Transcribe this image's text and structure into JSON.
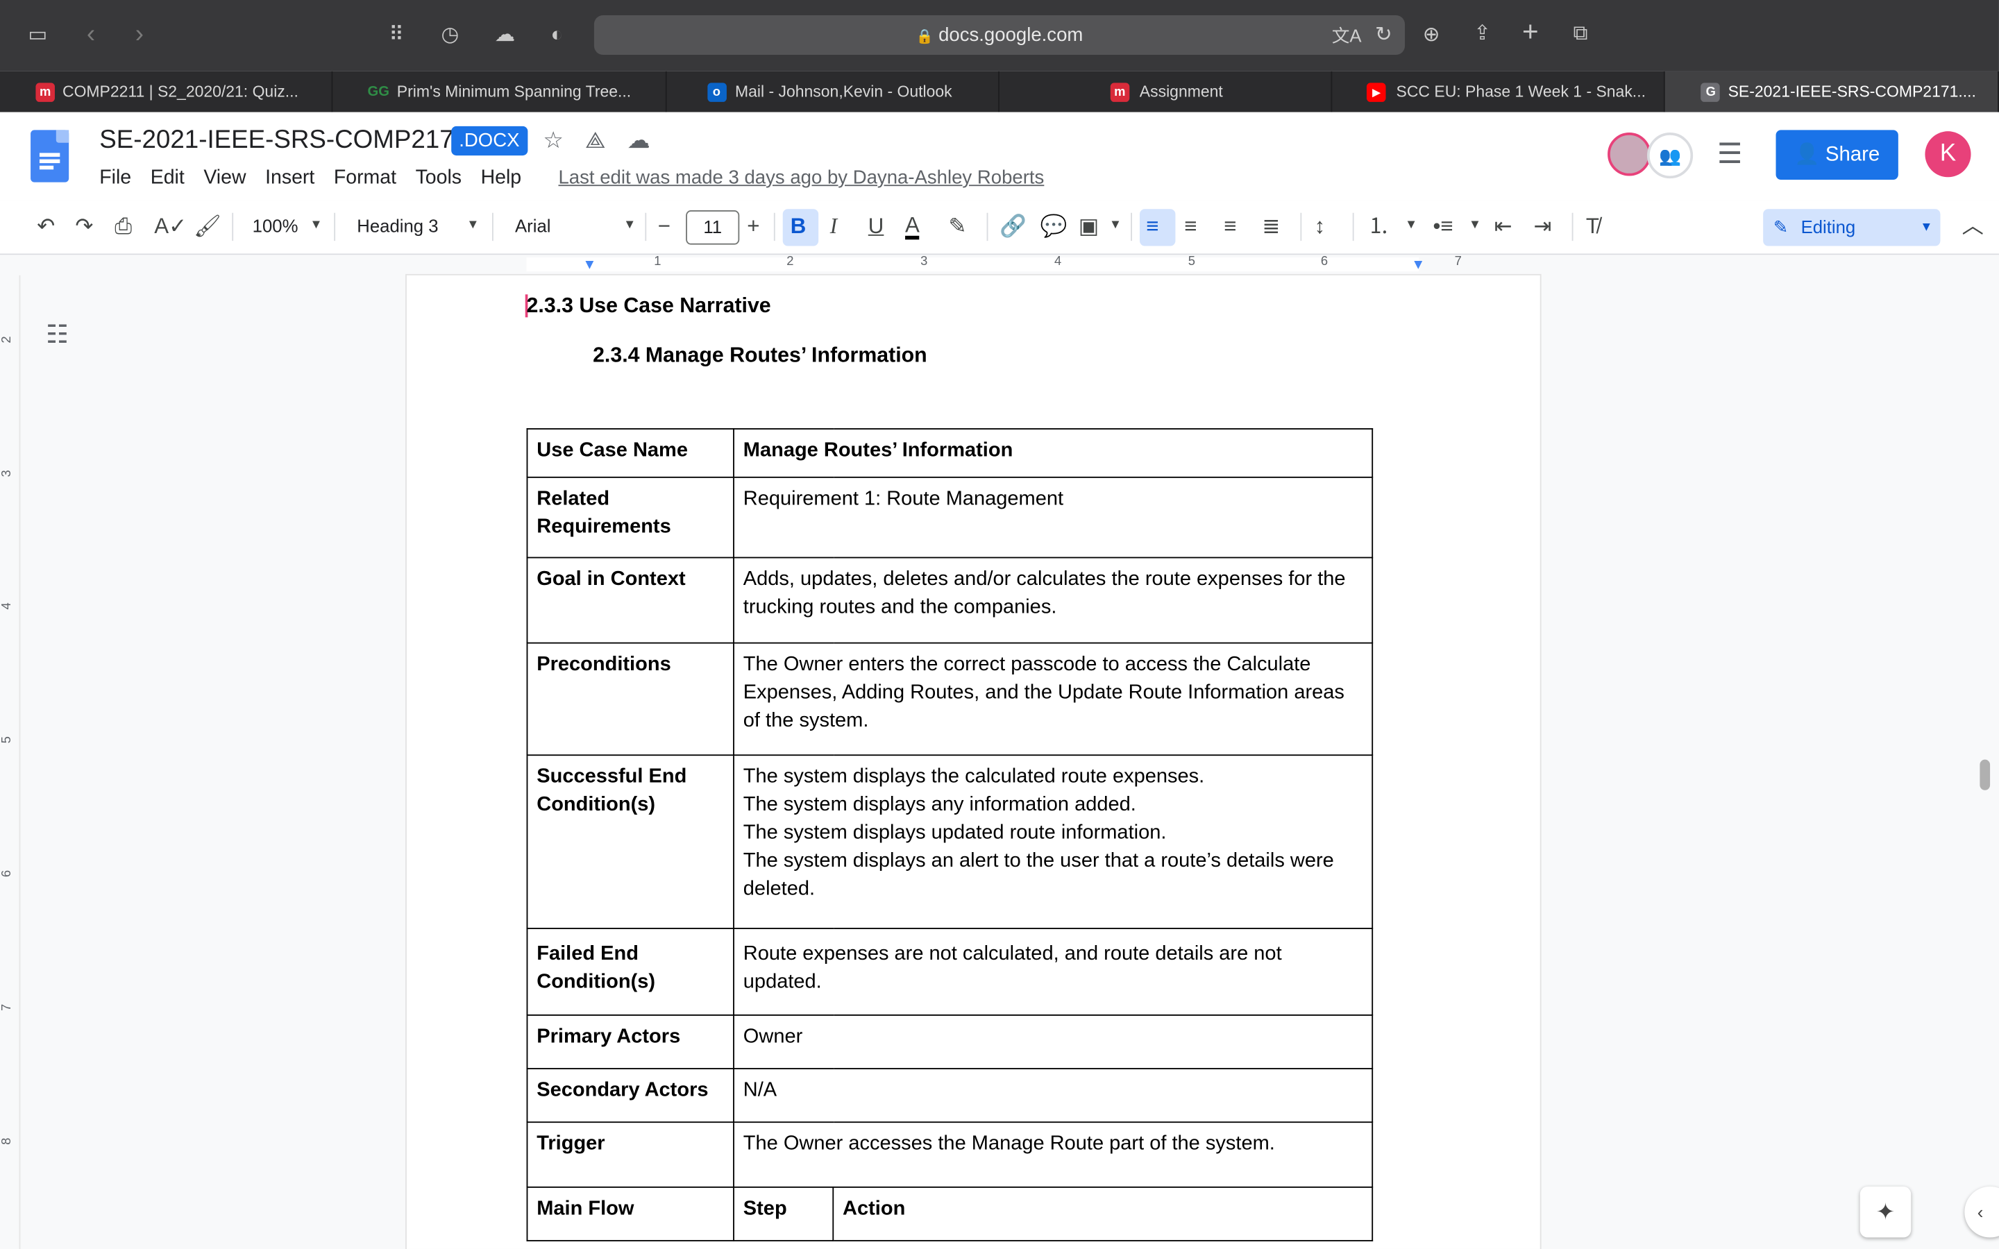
{
  "browser": {
    "url": "docs.google.com",
    "tabs": [
      {
        "label": "COMP2211 | S2_2020/21: Quiz...",
        "fav": "m",
        "color": "#d92b3a"
      },
      {
        "label": "Prim's Minimum Spanning Tree...",
        "fav": "gfg",
        "color": "#2f8d46"
      },
      {
        "label": "Mail - Johnson,Kevin - Outlook",
        "fav": "o",
        "color": "#0a64c8"
      },
      {
        "label": "Assignment",
        "fav": "m",
        "color": "#d92b3a"
      },
      {
        "label": "SCC EU: Phase 1 Week 1 - Snak...",
        "fav": "yt",
        "color": "#ff0000"
      },
      {
        "label": "SE-2021-IEEE-SRS-COMP2171....",
        "fav": "G",
        "color": "#6e6e73"
      }
    ]
  },
  "doc": {
    "title": "SE-2021-IEEE-SRS-COMP2171",
    "badge": ".DOCX",
    "menus": [
      "File",
      "Edit",
      "View",
      "Insert",
      "Format",
      "Tools",
      "Help"
    ],
    "last_edit": "Last edit was made 3 days ago by Dayna-Ashley Roberts",
    "share": "Share",
    "avatar_letter": "K"
  },
  "toolbar": {
    "zoom": "100%",
    "style": "Heading 3",
    "font": "Arial",
    "font_size": "11",
    "mode": "Editing"
  },
  "ruler": [
    "1",
    "2",
    "3",
    "4",
    "5",
    "6",
    "7"
  ],
  "vruler": [
    "2",
    "3",
    "4",
    "5",
    "6",
    "7",
    "8"
  ],
  "content": {
    "heading1": "2.3.3 Use Case Narrative",
    "heading2": "2.3.4 Manage Routes’ Information",
    "table": [
      {
        "key": "Use Case Name",
        "val": "Manage Routes’ Information",
        "bold": true
      },
      {
        "key": "Related Requirements",
        "val": "Requirement 1: Route Management"
      },
      {
        "key": "Goal in Context",
        "val": "Adds, updates, deletes and/or calculates the route expenses for the trucking routes and the companies."
      },
      {
        "key": "Preconditions",
        "val": "The Owner enters the correct passcode to access the Calculate Expenses, Adding Routes, and the Update Route Information areas of the system."
      },
      {
        "key": "Successful End Condition(s)",
        "lines": [
          "The system displays the calculated route expenses.",
          "The system displays any information added.",
          "The system displays updated route information.",
          "The system displays an alert to the user that a route’s details were deleted."
        ]
      },
      {
        "key": "Failed End Condition(s)",
        "val": "Route expenses are not calculated, and route details are not updated."
      },
      {
        "key": "Primary Actors",
        "val": "Owner"
      },
      {
        "key": "Secondary Actors",
        "val": "N/A"
      },
      {
        "key": "Trigger",
        "val": "The Owner accesses the Manage Route part of the system."
      }
    ],
    "main_flow": {
      "key": "Main Flow",
      "step": "Step",
      "action": "Action"
    }
  }
}
